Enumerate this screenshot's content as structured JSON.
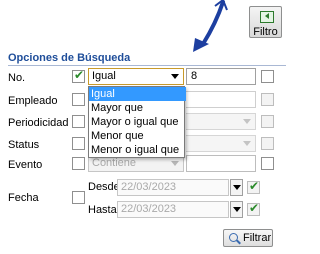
{
  "toolbar": {
    "filtro_label": "Filtro"
  },
  "section_title": "Opciones de Búsqueda",
  "rows": {
    "no": {
      "label": "No.",
      "operator": "Igual",
      "value": "8"
    },
    "empleado": {
      "label": "Empleado"
    },
    "periodicidad": {
      "label": "Periodicidad"
    },
    "status": {
      "label": "Status"
    },
    "evento": {
      "label": "Evento",
      "operator": "Contiene"
    },
    "fecha": {
      "label": "Fecha",
      "desde_label": "Desde",
      "desde_value": "22/03/2023",
      "hasta_label": "Hasta",
      "hasta_value": "22/03/2023"
    }
  },
  "dropdown": {
    "options": [
      "Igual",
      "Mayor que",
      "Mayor o igual que",
      "Menor que",
      "Menor o igual que"
    ],
    "selected": "Igual"
  },
  "filtrar_label": "Filtrar",
  "colors": {
    "section_title": "#1f4e9a",
    "selection": "#3399ff",
    "annotation_arrow": "#1d3fa0"
  },
  "icons": {
    "filtro": "filter-window-icon",
    "filtrar": "magnifier-icon"
  }
}
